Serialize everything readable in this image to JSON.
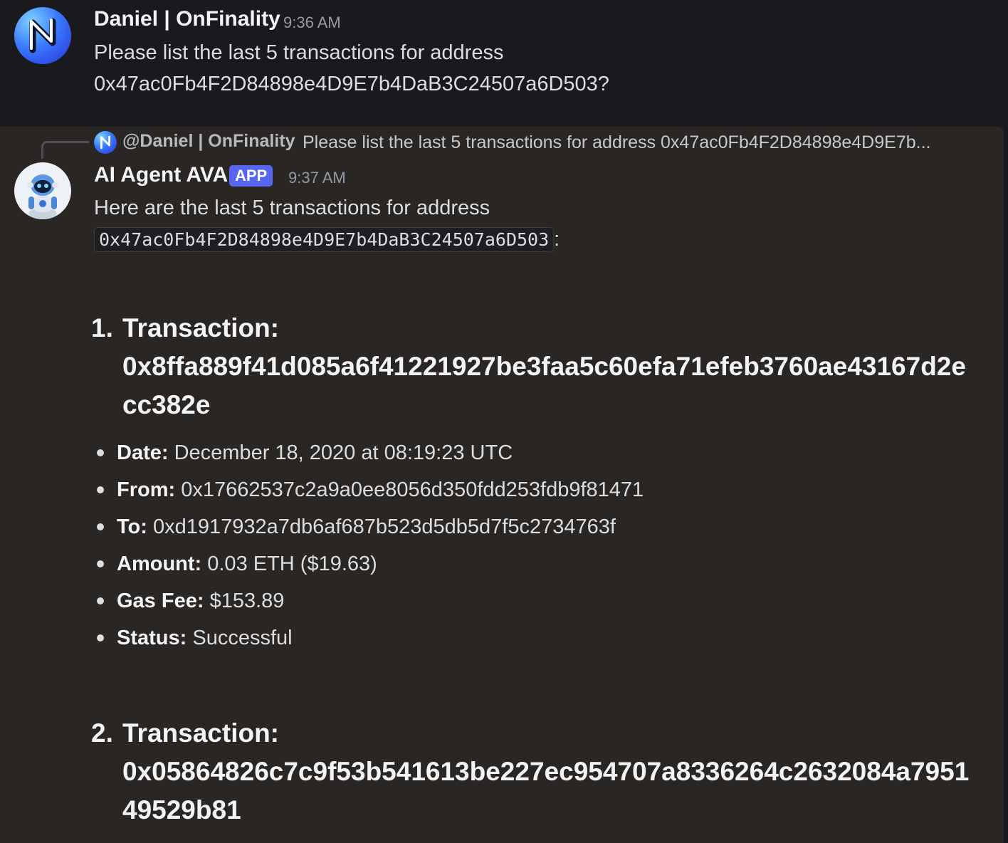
{
  "message1": {
    "username": "Daniel | OnFinality",
    "timestamp": "9:36 AM",
    "text_line1": "Please list the last 5 transactions for address",
    "text_line2": "0x47ac0Fb4F2D84898e4D9E7b4DaB3C24507a6D503?"
  },
  "message2": {
    "reply": {
      "user": "@Daniel | OnFinality",
      "text": "Please list the last 5 transactions for address 0x47ac0Fb4F2D84898e4D9E7b..."
    },
    "username": "AI Agent AVA",
    "badge": "APP",
    "timestamp": "9:37 AM",
    "intro": "Here are the last 5 transactions for address",
    "address_code": "0x47ac0Fb4F2D84898e4D9E7b4DaB3C24507a6D503",
    "address_suffix": ":",
    "transactions": [
      {
        "number": "1.",
        "label": "Transaction:",
        "hash": "0x8ffa889f41d085a6f41221927be3faa5c60efa71efeb3760ae43167d2ecc382e",
        "details": [
          {
            "key": "Date:",
            "value": "December 18, 2020 at 08:19:23 UTC"
          },
          {
            "key": "From:",
            "value": "0x17662537c2a9a0ee8056d350fdd253fdb9f81471"
          },
          {
            "key": "To:",
            "value": "0xd1917932a7db6af687b523d5db5d7f5c2734763f"
          },
          {
            "key": "Amount:",
            "value": "0.03 ETH ($19.63)"
          },
          {
            "key": "Gas Fee:",
            "value": "$153.89"
          },
          {
            "key": "Status:",
            "value": "Successful"
          }
        ]
      },
      {
        "number": "2.",
        "label": "Transaction:",
        "hash": "0x05864826c7c9f53b541613be227ec954707a8336264c2632084a795149529b81"
      }
    ]
  },
  "colors": {
    "badge": "#5865f2",
    "background": "#1a1a1e",
    "highlight": "#2a2623"
  }
}
